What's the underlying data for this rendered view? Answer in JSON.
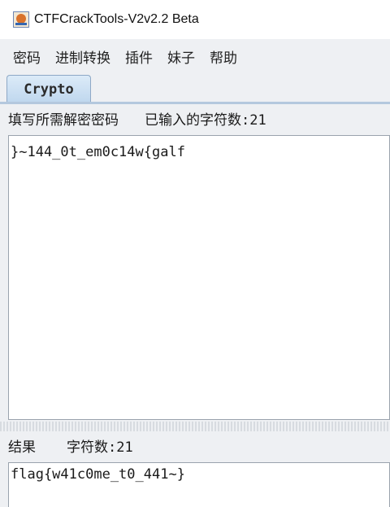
{
  "window": {
    "title": "CTFCrackTools-V2v2.2 Beta",
    "icon": "java-cup-icon"
  },
  "menu": {
    "items": [
      "密码",
      "进制转换",
      "插件",
      "妹子",
      "帮助"
    ]
  },
  "tabs": [
    {
      "label": "Crypto",
      "active": true
    }
  ],
  "input": {
    "label": "填写所需解密密码",
    "count_label": "已输入的字符数:21",
    "value": "}~144_0t_em0c14w{galf"
  },
  "result": {
    "label": "结果",
    "count_label": "字符数:21",
    "value": "flag{w41c0me_t0_441~}"
  },
  "colors": {
    "tab_active": "#c9def2",
    "background": "#eef0f3",
    "field_background": "#ffffff"
  }
}
